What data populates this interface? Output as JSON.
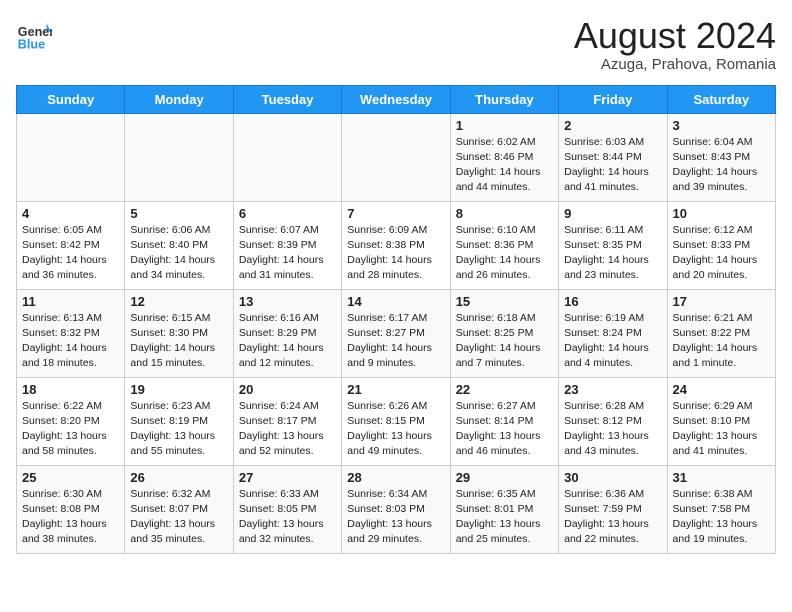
{
  "header": {
    "logo_line1": "General",
    "logo_line2": "Blue",
    "month_title": "August 2024",
    "location": "Azuga, Prahova, Romania"
  },
  "days_of_week": [
    "Sunday",
    "Monday",
    "Tuesday",
    "Wednesday",
    "Thursday",
    "Friday",
    "Saturday"
  ],
  "weeks": [
    [
      {
        "day": "",
        "info": ""
      },
      {
        "day": "",
        "info": ""
      },
      {
        "day": "",
        "info": ""
      },
      {
        "day": "",
        "info": ""
      },
      {
        "day": "1",
        "info": "Sunrise: 6:02 AM\nSunset: 8:46 PM\nDaylight: 14 hours and 44 minutes."
      },
      {
        "day": "2",
        "info": "Sunrise: 6:03 AM\nSunset: 8:44 PM\nDaylight: 14 hours and 41 minutes."
      },
      {
        "day": "3",
        "info": "Sunrise: 6:04 AM\nSunset: 8:43 PM\nDaylight: 14 hours and 39 minutes."
      }
    ],
    [
      {
        "day": "4",
        "info": "Sunrise: 6:05 AM\nSunset: 8:42 PM\nDaylight: 14 hours and 36 minutes."
      },
      {
        "day": "5",
        "info": "Sunrise: 6:06 AM\nSunset: 8:40 PM\nDaylight: 14 hours and 34 minutes."
      },
      {
        "day": "6",
        "info": "Sunrise: 6:07 AM\nSunset: 8:39 PM\nDaylight: 14 hours and 31 minutes."
      },
      {
        "day": "7",
        "info": "Sunrise: 6:09 AM\nSunset: 8:38 PM\nDaylight: 14 hours and 28 minutes."
      },
      {
        "day": "8",
        "info": "Sunrise: 6:10 AM\nSunset: 8:36 PM\nDaylight: 14 hours and 26 minutes."
      },
      {
        "day": "9",
        "info": "Sunrise: 6:11 AM\nSunset: 8:35 PM\nDaylight: 14 hours and 23 minutes."
      },
      {
        "day": "10",
        "info": "Sunrise: 6:12 AM\nSunset: 8:33 PM\nDaylight: 14 hours and 20 minutes."
      }
    ],
    [
      {
        "day": "11",
        "info": "Sunrise: 6:13 AM\nSunset: 8:32 PM\nDaylight: 14 hours and 18 minutes."
      },
      {
        "day": "12",
        "info": "Sunrise: 6:15 AM\nSunset: 8:30 PM\nDaylight: 14 hours and 15 minutes."
      },
      {
        "day": "13",
        "info": "Sunrise: 6:16 AM\nSunset: 8:29 PM\nDaylight: 14 hours and 12 minutes."
      },
      {
        "day": "14",
        "info": "Sunrise: 6:17 AM\nSunset: 8:27 PM\nDaylight: 14 hours and 9 minutes."
      },
      {
        "day": "15",
        "info": "Sunrise: 6:18 AM\nSunset: 8:25 PM\nDaylight: 14 hours and 7 minutes."
      },
      {
        "day": "16",
        "info": "Sunrise: 6:19 AM\nSunset: 8:24 PM\nDaylight: 14 hours and 4 minutes."
      },
      {
        "day": "17",
        "info": "Sunrise: 6:21 AM\nSunset: 8:22 PM\nDaylight: 14 hours and 1 minute."
      }
    ],
    [
      {
        "day": "18",
        "info": "Sunrise: 6:22 AM\nSunset: 8:20 PM\nDaylight: 13 hours and 58 minutes."
      },
      {
        "day": "19",
        "info": "Sunrise: 6:23 AM\nSunset: 8:19 PM\nDaylight: 13 hours and 55 minutes."
      },
      {
        "day": "20",
        "info": "Sunrise: 6:24 AM\nSunset: 8:17 PM\nDaylight: 13 hours and 52 minutes."
      },
      {
        "day": "21",
        "info": "Sunrise: 6:26 AM\nSunset: 8:15 PM\nDaylight: 13 hours and 49 minutes."
      },
      {
        "day": "22",
        "info": "Sunrise: 6:27 AM\nSunset: 8:14 PM\nDaylight: 13 hours and 46 minutes."
      },
      {
        "day": "23",
        "info": "Sunrise: 6:28 AM\nSunset: 8:12 PM\nDaylight: 13 hours and 43 minutes."
      },
      {
        "day": "24",
        "info": "Sunrise: 6:29 AM\nSunset: 8:10 PM\nDaylight: 13 hours and 41 minutes."
      }
    ],
    [
      {
        "day": "25",
        "info": "Sunrise: 6:30 AM\nSunset: 8:08 PM\nDaylight: 13 hours and 38 minutes."
      },
      {
        "day": "26",
        "info": "Sunrise: 6:32 AM\nSunset: 8:07 PM\nDaylight: 13 hours and 35 minutes."
      },
      {
        "day": "27",
        "info": "Sunrise: 6:33 AM\nSunset: 8:05 PM\nDaylight: 13 hours and 32 minutes."
      },
      {
        "day": "28",
        "info": "Sunrise: 6:34 AM\nSunset: 8:03 PM\nDaylight: 13 hours and 29 minutes."
      },
      {
        "day": "29",
        "info": "Sunrise: 6:35 AM\nSunset: 8:01 PM\nDaylight: 13 hours and 25 minutes."
      },
      {
        "day": "30",
        "info": "Sunrise: 6:36 AM\nSunset: 7:59 PM\nDaylight: 13 hours and 22 minutes."
      },
      {
        "day": "31",
        "info": "Sunrise: 6:38 AM\nSunset: 7:58 PM\nDaylight: 13 hours and 19 minutes."
      }
    ]
  ]
}
